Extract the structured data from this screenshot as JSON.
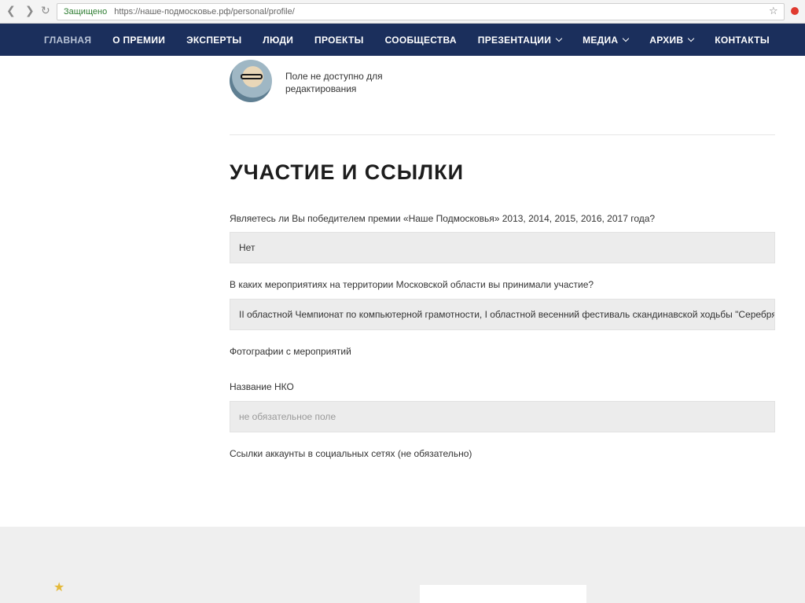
{
  "browser": {
    "back_icon": "back-arrow-icon",
    "forward_icon": "forward-arrow-icon",
    "reload_icon": "reload-icon",
    "secure_label": "Защищено",
    "url": "https://наше-подмосковье.рф/personal/profile/",
    "bookmark_icon": "star-icon"
  },
  "nav": {
    "items": [
      {
        "label": "ГЛАВНАЯ",
        "active": true,
        "dropdown": false
      },
      {
        "label": "О ПРЕМИИ",
        "dropdown": false
      },
      {
        "label": "ЭКСПЕРТЫ",
        "dropdown": false
      },
      {
        "label": "ЛЮДИ",
        "dropdown": false
      },
      {
        "label": "ПРОЕКТЫ",
        "dropdown": false
      },
      {
        "label": "СООБЩЕСТВА",
        "dropdown": false
      },
      {
        "label": "ПРЕЗЕНТАЦИИ",
        "dropdown": true
      },
      {
        "label": "МЕДИА",
        "dropdown": true
      },
      {
        "label": "АРХИВ",
        "dropdown": true
      },
      {
        "label": "КОНТАКТЫ",
        "dropdown": false
      }
    ]
  },
  "profile": {
    "avatar_note": "Поле не доступно для редактирования"
  },
  "section": {
    "title": "УЧАСТИЕ И ССЫЛКИ",
    "winner_question": "Являетесь ли Вы победителем премии «Наше Подмосковья» 2013, 2014, 2015, 2016, 2017 года?",
    "winner_value": "Нет",
    "events_question": "В каких мероприятиях на территории Московской области вы принимали участие?",
    "events_value": "II областной Чемпионат по компьютерной грамотности,  I областной весенний фестиваль скандинавской ходьбы \"Серебряные тропы Подмосковья\"",
    "photos_label": "Фотографии с мероприятий",
    "nko_label": "Название НКО",
    "nko_placeholder": "не обязательное поле",
    "social_label": "Ссылки аккаунты в социальных сетях (не обязательно)"
  },
  "colors": {
    "nav_background": "#1b2f5c",
    "field_background": "#ececec",
    "footer_background": "#efefef"
  }
}
